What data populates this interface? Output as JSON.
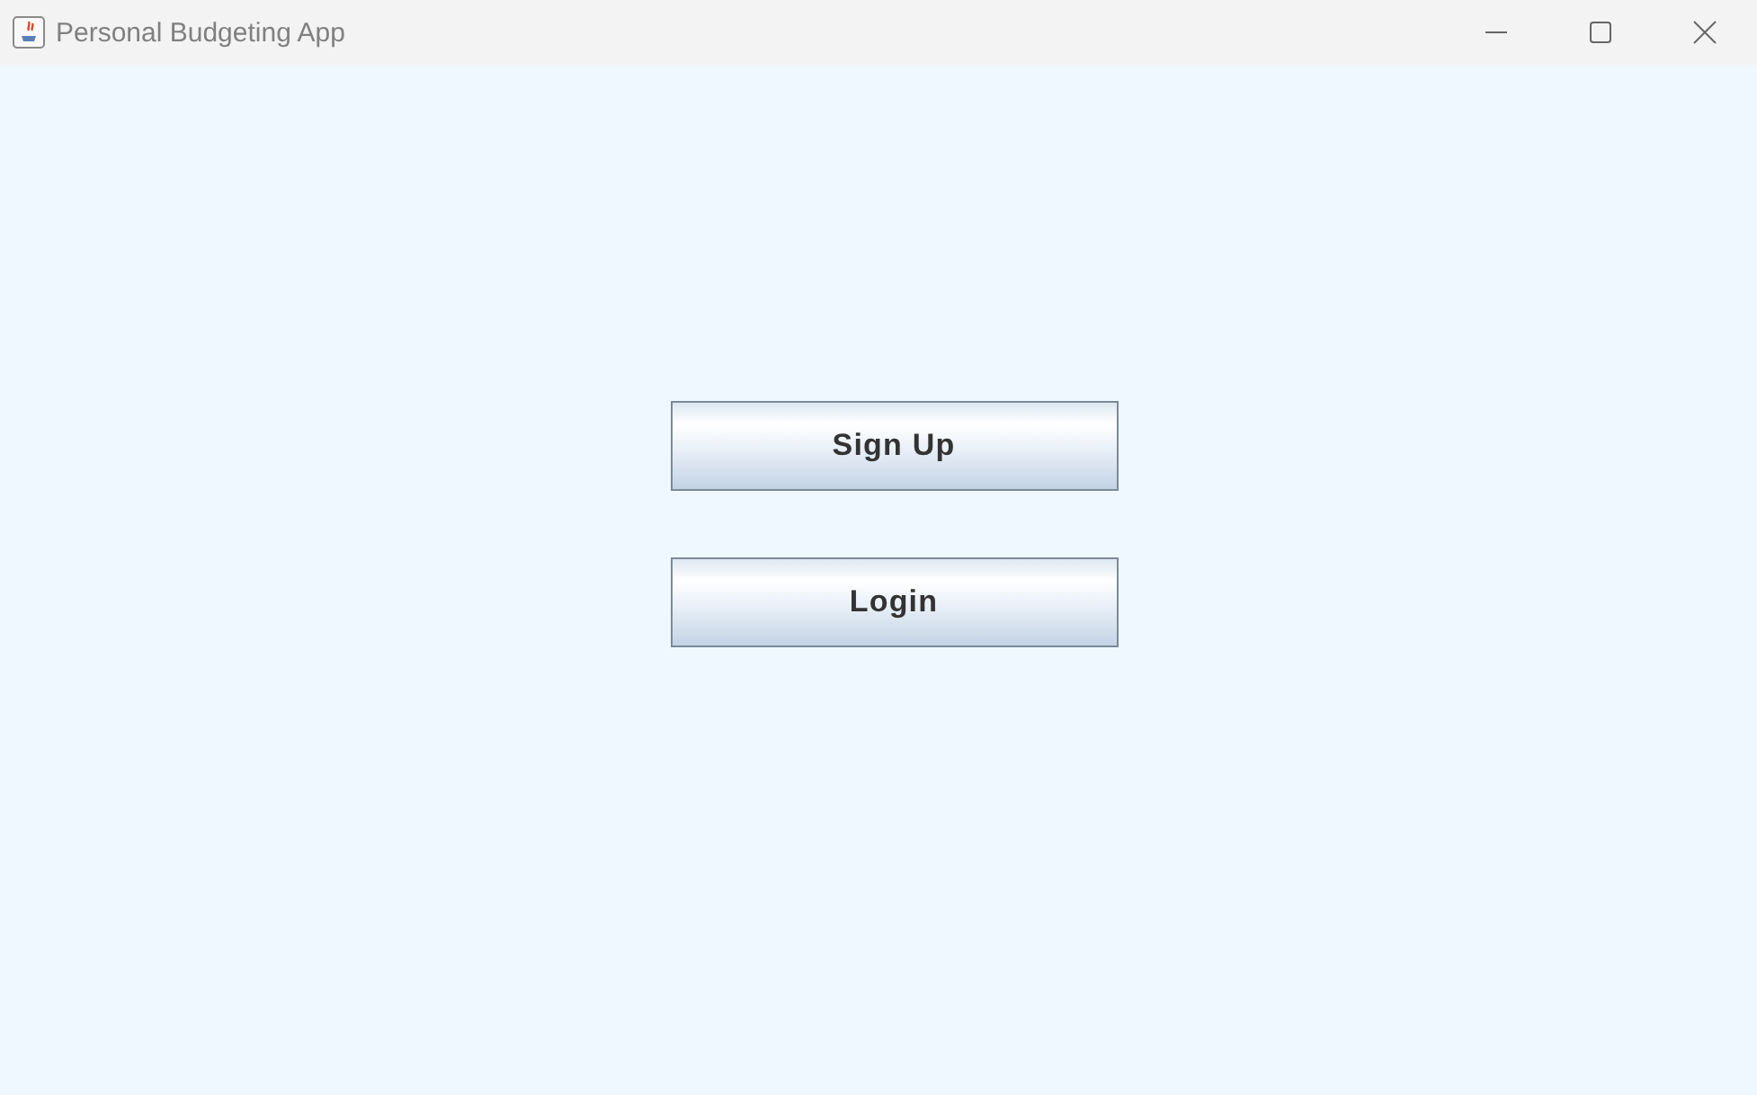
{
  "window": {
    "title": "Personal Budgeting App"
  },
  "buttons": [
    {
      "label": "Sign Up"
    },
    {
      "label": "Login"
    }
  ]
}
